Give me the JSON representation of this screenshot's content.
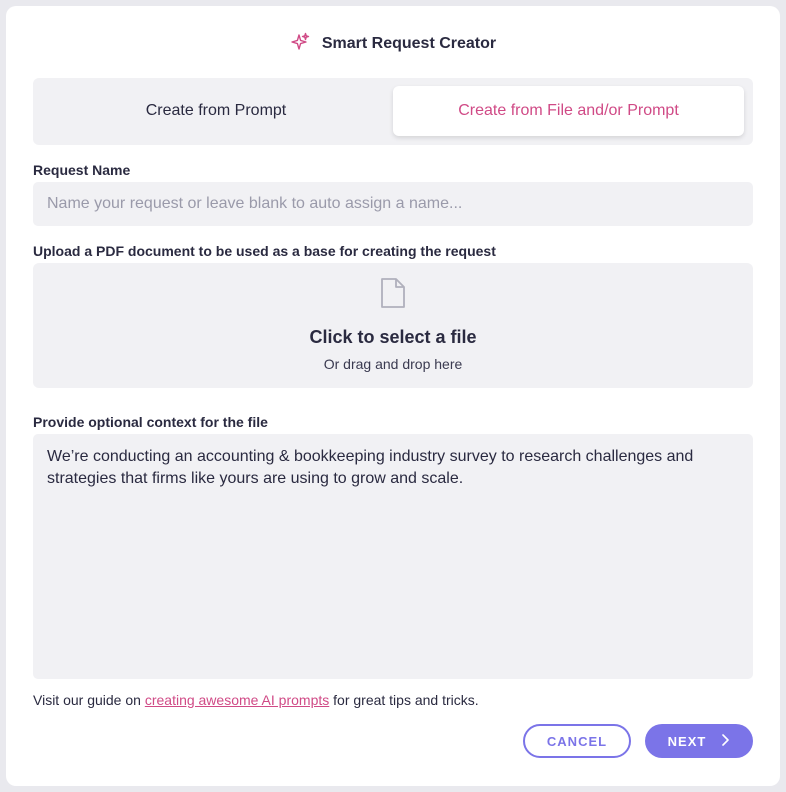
{
  "header": {
    "title": "Smart Request Creator",
    "icon": "sparkle-icon",
    "accent_color": "#d04a86"
  },
  "tabs": [
    {
      "label": "Create from Prompt",
      "active": false
    },
    {
      "label": "Create from File and/or Prompt",
      "active": true
    }
  ],
  "request_name": {
    "label": "Request Name",
    "placeholder": "Name your request or leave blank to auto assign a name...",
    "value": ""
  },
  "upload": {
    "label": "Upload a PDF document to be used as a base for creating the request",
    "icon": "file-icon",
    "main_text": "Click to select a file",
    "sub_text": "Or drag and drop here"
  },
  "context": {
    "label": "Provide optional context for the file",
    "value": "We’re conducting an accounting & bookkeeping industry survey to research challenges and strategies that firms like yours are using to grow and scale."
  },
  "guide": {
    "prefix": "Visit our guide on ",
    "link_text": "creating awesome AI prompts",
    "suffix": " for great tips and tricks."
  },
  "buttons": {
    "cancel": "CANCEL",
    "next": "NEXT",
    "primary_color": "#7b74e8"
  }
}
